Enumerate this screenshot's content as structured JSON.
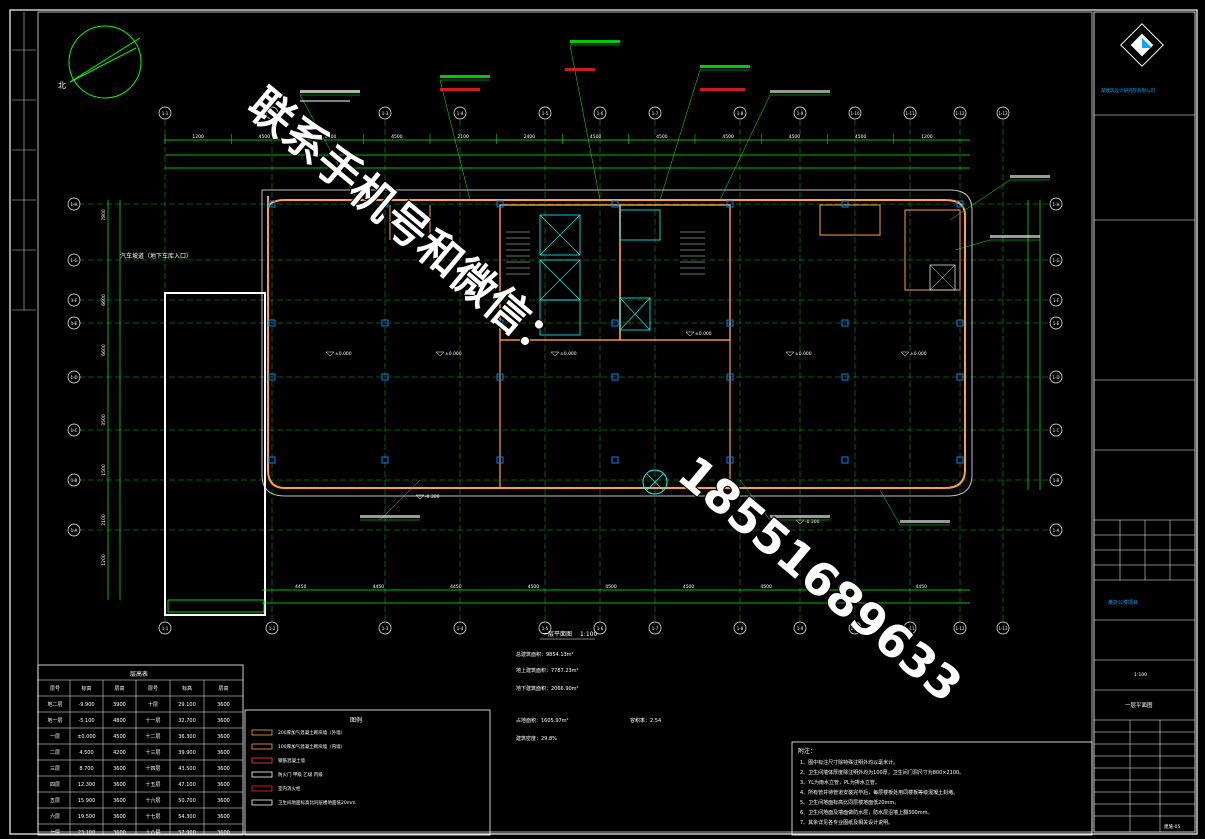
{
  "drawing": {
    "north_label": "北",
    "plan_title": "一层平面图",
    "plan_scale": "1:100",
    "table_title": "层高表",
    "legend_title": "图例",
    "notes_title": "附注：",
    "watermark_cn": "联系手机号和微信：",
    "watermark_phone": "18551689633"
  },
  "axes": {
    "top": [
      "1-1",
      "1-2",
      "1-3",
      "1-4",
      "1-5",
      "1-6",
      "1-7",
      "1-8",
      "1-9",
      "1-10",
      "1-11",
      "1-12",
      "1-13"
    ],
    "left": [
      "1-H",
      "1-G",
      "1-F",
      "1-E",
      "1-D",
      "1-C",
      "1-B",
      "1-A"
    ]
  },
  "dims_top": [
    "1200",
    "4500",
    "4500",
    "4500",
    "2100",
    "2400",
    "4500",
    "4500",
    "4500",
    "4500",
    "4500",
    "1200"
  ],
  "dims_bottom": [
    "4450",
    "4450",
    "4450",
    "4500",
    "4500",
    "4500",
    "4500",
    "4500",
    "4450"
  ],
  "dims_left": [
    "7800",
    "6600",
    "6600",
    "3500",
    "1500",
    "2100",
    "1200"
  ],
  "elevations": [
    "±0.000",
    "±0.000",
    "±0.000",
    "±0.000",
    "±0.000",
    "±0.000",
    "-0.300",
    "-0.300"
  ],
  "annex_label": "汽车坡道（地下车库入口）",
  "areas": [
    "总建筑面积：9854.13m²",
    "地上建筑面积：7787.23m²",
    "地下建筑面积：2066.90m²",
    "占地面积：1605.97m²",
    "容积率：2.54",
    "建筑密度：29.8%"
  ],
  "floor_table": {
    "headers": [
      "层号",
      "标高",
      "层高",
      "层号",
      "标高",
      "层高"
    ],
    "rows": [
      [
        "地二层",
        "-9.900",
        "3900",
        "十层",
        "29.100",
        "3600"
      ],
      [
        "地一层",
        "-5.100",
        "4800",
        "十一层",
        "32.700",
        "3600"
      ],
      [
        "一层",
        "±0.000",
        "4500",
        "十二层",
        "36.300",
        "3600"
      ],
      [
        "二层",
        "4.500",
        "4200",
        "十三层",
        "39.900",
        "3600"
      ],
      [
        "三层",
        "8.700",
        "3600",
        "十四层",
        "43.500",
        "3600"
      ],
      [
        "四层",
        "12.300",
        "3600",
        "十五层",
        "47.100",
        "3600"
      ],
      [
        "五层",
        "15.900",
        "3600",
        "十六层",
        "50.700",
        "3600"
      ],
      [
        "六层",
        "19.500",
        "3600",
        "十七层",
        "54.300",
        "3600"
      ],
      [
        "七层",
        "23.100",
        "3600",
        "十八层",
        "57.900",
        "3600"
      ]
    ]
  },
  "legend": [
    "200厚加气混凝土砌块墙（外墙）",
    "100厚加气混凝土砌块墙（内墙）",
    "钢筋混凝土墙",
    "防火门  甲级  乙级  丙级",
    "室内消火栓",
    "卫生间地面标高比同层楼地面低20mm"
  ],
  "notes": [
    "1、图中标注尺寸除特殊注明外均以毫米计。",
    "2、卫生间墙体厚度除注明外均为100厚，卫生间门洞尺寸为800×2100。",
    "3、YL为雨水立管，PL为排水立管。",
    "4、所有管井待管道安装完毕后，每层楼板处用同楼板等级混凝土封堵。",
    "5、卫生间地面标高比同层楼地面低20mm。",
    "6、卫生间地面及墙面做防水层，防水层沿墙上翻300mm。",
    "7、其余详见各专业图纸及相关设计说明。"
  ],
  "title_block": {
    "company": "某建筑设计研究院有限公司",
    "project": "某办公楼项目",
    "sheet_name": "一层平面图",
    "sheet_no": "建施-05",
    "scale": "1:100"
  },
  "colors": {
    "background": "#000000",
    "frame": "#ffffff",
    "axis_lines": "#00ff00",
    "walls": "#ff7f00",
    "dims": "#00ff7f",
    "columns": "#0080ff",
    "text": "#ffffff",
    "marker_red": "#ff2020",
    "accent_cyan": "#00ffff",
    "magenta": "#ff00ff",
    "yellow": "#ffff00"
  }
}
